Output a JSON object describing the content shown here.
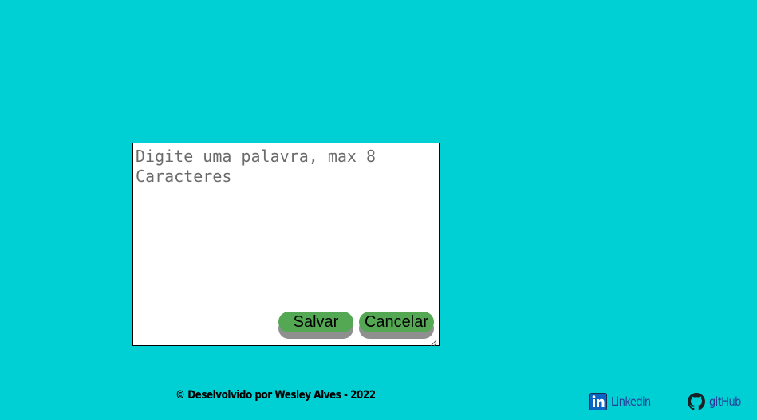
{
  "editor": {
    "placeholder": "Digite uma palavra, max 8 Caracteres",
    "value": ""
  },
  "actions": {
    "save_label": "Salvar",
    "cancel_label": "Cancelar"
  },
  "footer": {
    "credit": "© Deselvolvido por Wesley Alves - 2022",
    "linkedin_label": "Linkedin",
    "github_label": "gitHub"
  },
  "colors": {
    "background": "#00cfd3",
    "button": "#55a853",
    "button_shadow": "#8f8f8f",
    "link": "#2a3b9a"
  },
  "icons": {
    "linkedin": "linkedin-icon",
    "github": "github-icon",
    "resize": "resize-grip-icon"
  }
}
